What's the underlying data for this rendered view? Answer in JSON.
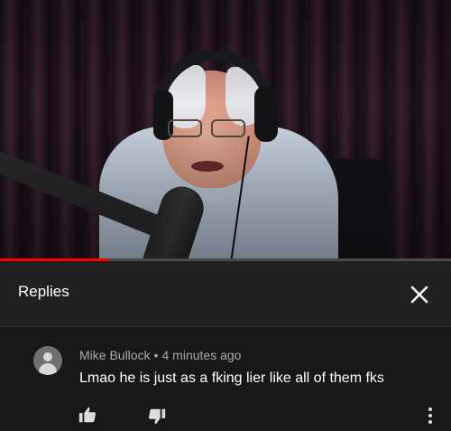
{
  "video": {
    "progress_fraction": 0.24,
    "progress_color": "#ff0000"
  },
  "replies": {
    "title": "Replies",
    "close_icon": "close-icon"
  },
  "comment": {
    "author": "Mike Bullock",
    "separator": "•",
    "time": "4 minutes ago",
    "text": "Lmao he is just as a fking lier like all of them fks",
    "avatar_icon": "default-avatar-icon",
    "like_icon": "thumbs-up-icon",
    "dislike_icon": "thumbs-down-icon",
    "more_icon": "more-vert-icon"
  }
}
